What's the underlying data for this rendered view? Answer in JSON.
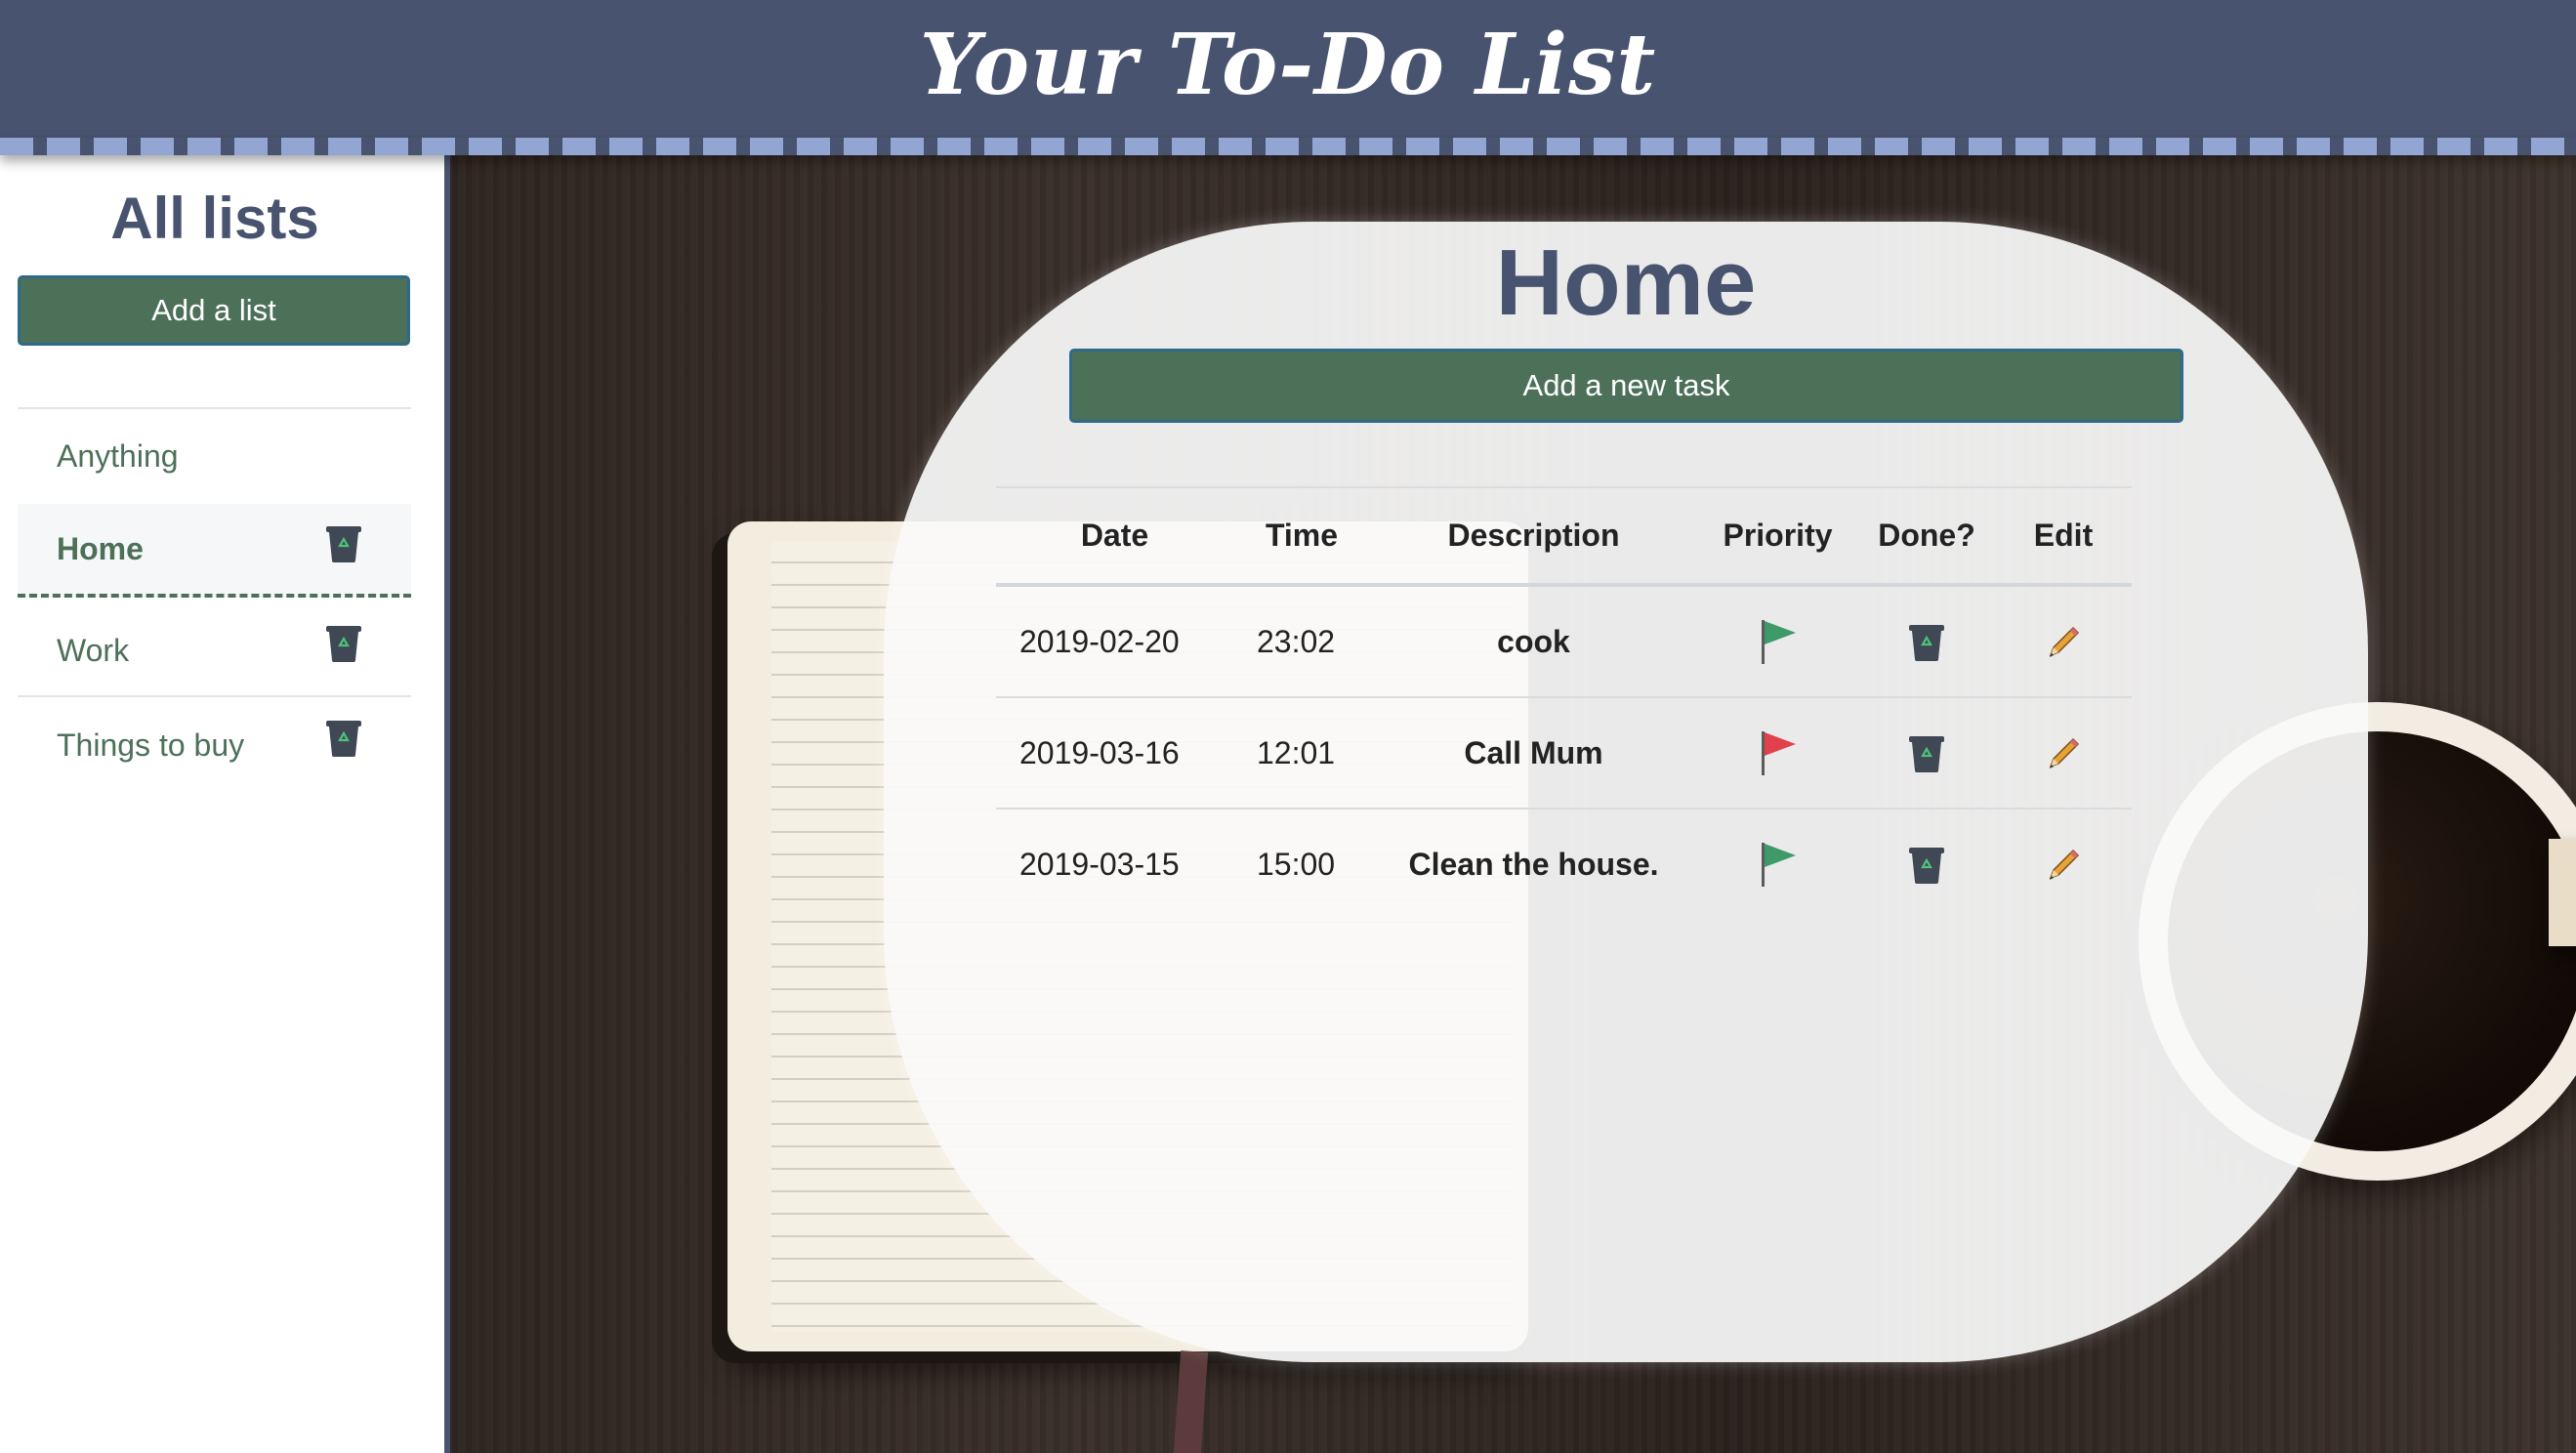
{
  "header": {
    "title": "Your To-Do List"
  },
  "sidebar": {
    "title": "All lists",
    "add_list_label": "Add a list",
    "items": [
      {
        "label": "Anything",
        "active": false,
        "deletable": false
      },
      {
        "label": "Home",
        "active": true,
        "deletable": true
      },
      {
        "label": "Work",
        "active": false,
        "deletable": true
      },
      {
        "label": "Things to buy",
        "active": false,
        "deletable": true
      }
    ]
  },
  "main": {
    "list_title": "Home",
    "add_task_label": "Add a new task",
    "columns": {
      "date": "Date",
      "time": "Time",
      "description": "Description",
      "priority": "Priority",
      "done": "Done?",
      "edit": "Edit"
    },
    "tasks": [
      {
        "date": "2019-02-20",
        "time": "23:02",
        "description": "cook",
        "priority_flag": "green"
      },
      {
        "date": "2019-03-16",
        "time": "12:01",
        "description": "Call Mum",
        "priority_flag": "red"
      },
      {
        "date": "2019-03-15",
        "time": "15:00",
        "description": "Clean the house.",
        "priority_flag": "green"
      }
    ]
  },
  "icons": {
    "priority": "flag-icon",
    "done": "trash-icon",
    "edit": "pencil-icon"
  },
  "colors": {
    "header_bg": "#48536f",
    "accent_green": "#4d7059",
    "flag_green": "#3f9a6a",
    "flag_red": "#e0414a",
    "title_text": "#48536f"
  }
}
